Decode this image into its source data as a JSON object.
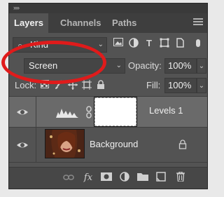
{
  "window": {
    "collapse_glyph": "»»"
  },
  "tabs": [
    {
      "label": "Layers",
      "active": true
    },
    {
      "label": "Channels",
      "active": false
    },
    {
      "label": "Paths",
      "active": false
    }
  ],
  "filter": {
    "value": "Kind"
  },
  "blend": {
    "mode": "Screen",
    "opacity_label": "Opacity:",
    "opacity_value": "100%"
  },
  "lock": {
    "label": "Lock:",
    "fill_label": "Fill:",
    "fill_value": "100%"
  },
  "layers": [
    {
      "name": "Levels 1",
      "type": "adjustment",
      "selected": true
    },
    {
      "name": "Background",
      "type": "image",
      "selected": false,
      "locked": true
    }
  ],
  "bottom_icons": [
    "link-layers-icon",
    "fx-icon",
    "layer-mask-icon",
    "adjustment-layer-icon",
    "new-group-icon",
    "new-layer-icon",
    "delete-icon"
  ],
  "bottom": {
    "fx_text": "fx"
  },
  "colors": {
    "panel": "#535353",
    "selected_row": "#6a6a6a",
    "highlight": "#e01b1b"
  }
}
